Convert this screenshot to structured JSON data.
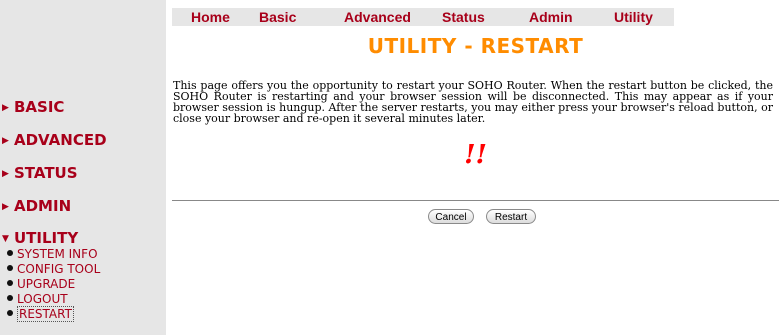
{
  "topnav": {
    "items": [
      "Home",
      "Basic",
      "Advanced",
      "Status",
      "Admin",
      "Utility"
    ]
  },
  "sidebar": {
    "sections": [
      {
        "label": "BASIC",
        "arrow": "▶"
      },
      {
        "label": "ADVANCED",
        "arrow": "▶"
      },
      {
        "label": "STATUS",
        "arrow": "▶"
      },
      {
        "label": "ADMIN",
        "arrow": "▶"
      },
      {
        "label": "UTILITY",
        "arrow": "▼"
      }
    ],
    "utility_items": [
      "SYSTEM INFO",
      "CONFIG TOOL",
      "UPGRADE",
      "LOGOUT",
      "RESTART"
    ],
    "current_item": "RESTART"
  },
  "main": {
    "title": "UTILITY - RESTART",
    "description": "This page offers you the opportunity to restart your SOHO Router. When the restart button be clicked, the SOHO Router is restarting and your browser session will be disconnected. This may appear as if your browser session is hungup. After the server restarts, you may either press your browser's reload button, or close your browser and re-open it several minutes later.",
    "warning": "!!",
    "cancel_label": "Cancel",
    "restart_label": "Restart"
  },
  "colors": {
    "accent_red": "#a8001a",
    "title_orange": "#ff8c00",
    "warning_red": "#ff0000",
    "panel_gray": "#e6e6e6"
  }
}
